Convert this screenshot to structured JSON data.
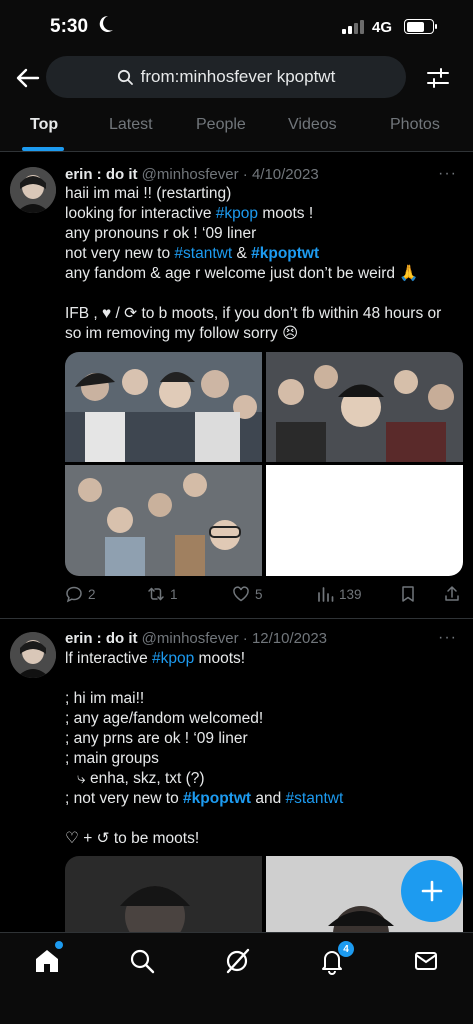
{
  "status_bar": {
    "time": "5:30",
    "network": "4G"
  },
  "header": {
    "search_query": "from:minhosfever kpoptwt"
  },
  "tabs": [
    {
      "label": "Top",
      "active": true
    },
    {
      "label": "Latest",
      "active": false
    },
    {
      "label": "People",
      "active": false
    },
    {
      "label": "Videos",
      "active": false
    },
    {
      "label": "Photos",
      "active": false
    }
  ],
  "posts": [
    {
      "name": "erin : do it",
      "handle": "@minhosfever",
      "date": "· 4/10/2023",
      "more": "···",
      "lines": {
        "l1": "haii im mai !! (restarting)",
        "l2_pre": "looking for interactive ",
        "l2_tag": "#kpop",
        "l2_post": " moots !",
        "l3": "any pronouns r ok ! ‘09 liner",
        "l4_pre": "not very new to ",
        "l4_tag1": "#stantwt",
        "l4_mid": " & ",
        "l4_tag2": "#kpoptwt",
        "l5": "any fandom & age r welcome just don’t be weird 🙏",
        "l6": "IFB , ♥︎ / ⟳ to b moots, if you don’t fb within 48 hours or",
        "l7": "so im removing my follow sorry 😣"
      },
      "stats": {
        "replies": "2",
        "reposts": "1",
        "likes": "5",
        "views": "139"
      }
    },
    {
      "name": "erin : do it",
      "handle": "@minhosfever",
      "date": "· 12/10/2023",
      "more": "···",
      "lines": {
        "l1_pre": "lf interactive ",
        "l1_tag": "#kpop",
        "l1_post": " moots!",
        "l2": "; hi im mai!!",
        "l3": "; any age/fandom welcomed!",
        "l4": "; any prns are ok ! ‘09 liner",
        "l5": "; main groups",
        "l6": "⤷ enha, skz, txt (?)",
        "l7_pre": "; not very new to ",
        "l7_tag1": "#kpoptwt",
        "l7_mid": " and ",
        "l7_tag2": "#stantwt",
        "l8": "♡ + ↺ to be moots!"
      }
    }
  ],
  "notifications_badge": "4",
  "icons": [
    "back-arrow-icon",
    "search-icon",
    "filter-icon",
    "more-icon",
    "reply-icon",
    "repost-icon",
    "like-icon",
    "views-icon",
    "bookmark-icon",
    "share-icon",
    "compose-plus-icon",
    "home-icon",
    "explore-icon",
    "grok-icon",
    "notifications-icon",
    "messages-icon",
    "moon-icon",
    "battery-icon"
  ],
  "colors": {
    "accent": "#1d9bf0",
    "background": "#000000",
    "muted": "#71767b",
    "text": "#e7e9ea"
  }
}
